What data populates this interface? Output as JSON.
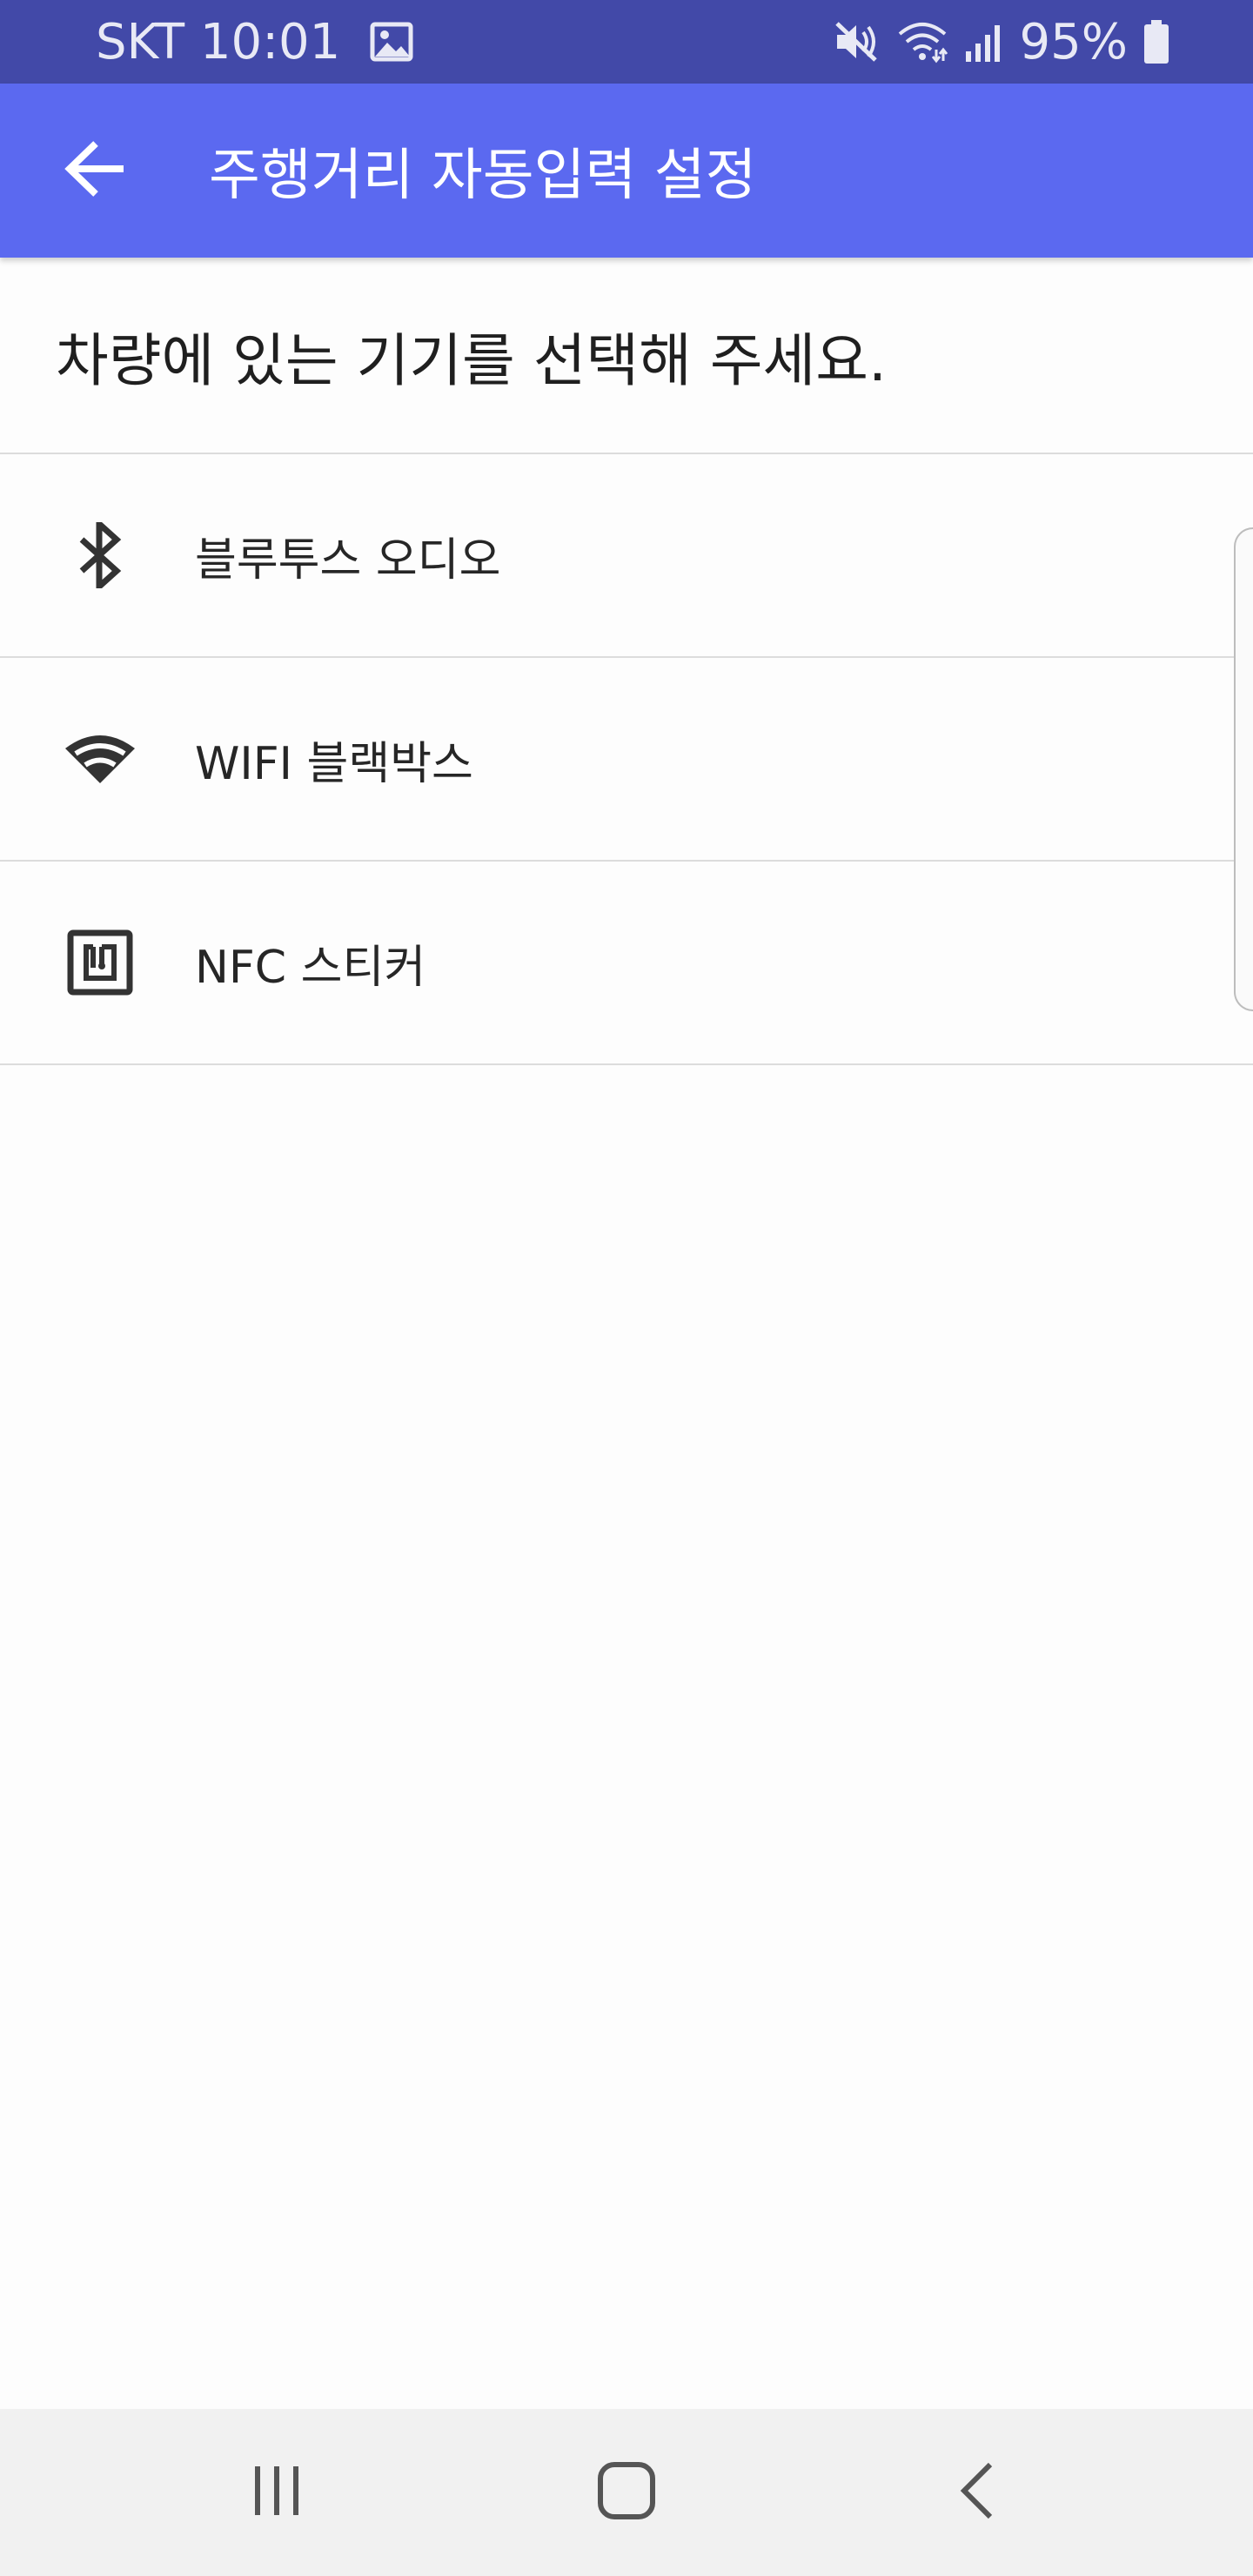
{
  "status_bar": {
    "carrier_time": "SKT 10:01",
    "battery_percent": "95%",
    "icons": [
      "gallery-icon",
      "mute-icon",
      "wifi-icon",
      "signal-icon",
      "battery-icon"
    ]
  },
  "app_bar": {
    "title": "주행거리 자동입력 설정",
    "back_icon": "arrow-back-icon",
    "color": "#5b69f0"
  },
  "prompt": "차량에 있는 기기를 선택해 주세요.",
  "devices": [
    {
      "icon": "bluetooth-icon",
      "label": "블루투스 오디오"
    },
    {
      "icon": "wifi-icon",
      "label": "WIFI 블랙박스"
    },
    {
      "icon": "nfc-icon",
      "label": "NFC 스티커"
    }
  ],
  "nav_bar": {
    "buttons": [
      "recent-apps-icon",
      "home-icon",
      "back-icon"
    ]
  },
  "colors": {
    "status_bar": "#4249a8",
    "app_bar": "#5b69f0",
    "background": "#fdfdfd",
    "nav_bar": "#f1f1f1"
  }
}
